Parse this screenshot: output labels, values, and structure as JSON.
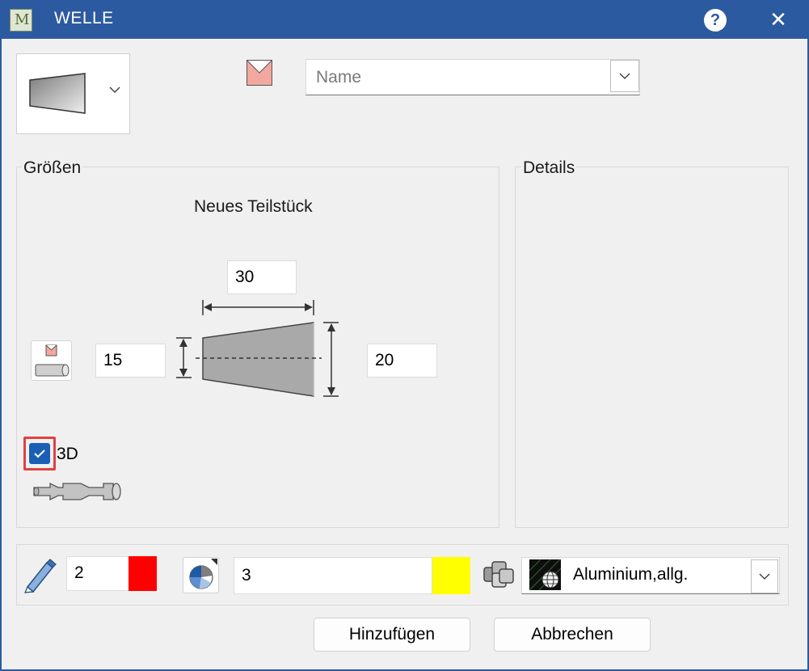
{
  "window": {
    "title": "WELLE",
    "app_icon_letter": "M"
  },
  "header": {
    "shape_selector": {
      "icon": "tapered-shaft-segment-icon"
    },
    "name_field": {
      "icon": "envelope-icon",
      "placeholder": "Name",
      "value": ""
    }
  },
  "groups": {
    "sizes_label": "Größen",
    "details_label": "Details"
  },
  "sizes": {
    "part_title": "Neues Teilstück",
    "length": "30",
    "diameter_left": "15",
    "diameter_right": "20",
    "checkbox_3d": {
      "label": "3D",
      "checked": true
    }
  },
  "bottom": {
    "pen_value": "2",
    "pen_color": "#ff0000",
    "fill_value": "3",
    "fill_color": "#ffff00",
    "material": "Aluminium,allg."
  },
  "buttons": {
    "add": "Hinzufügen",
    "cancel": "Abbrechen"
  }
}
